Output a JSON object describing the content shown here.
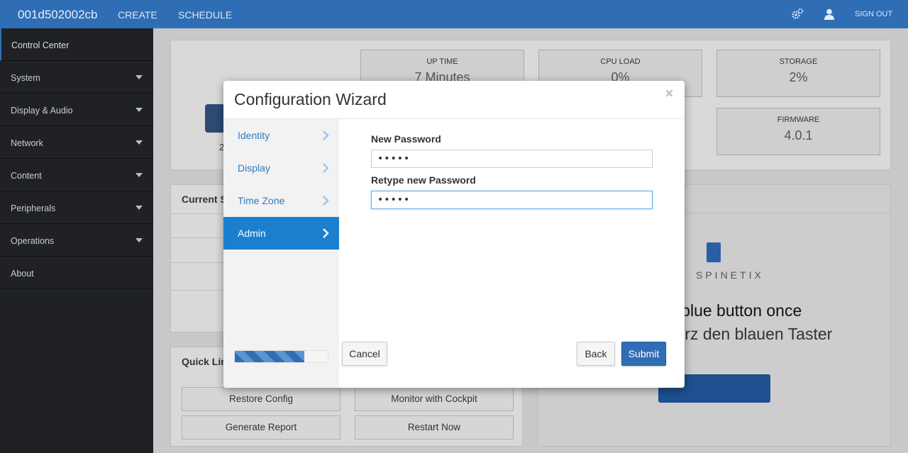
{
  "topbar": {
    "device_name": "001d502002cb",
    "create": "CREATE",
    "schedule": "SCHEDULE",
    "signout": "SIGN OUT"
  },
  "sidebar": {
    "items": [
      {
        "label": "Control Center"
      },
      {
        "label": "System"
      },
      {
        "label": "Display & Audio"
      },
      {
        "label": "Network"
      },
      {
        "label": "Content"
      },
      {
        "label": "Peripherals"
      },
      {
        "label": "Operations"
      },
      {
        "label": "About"
      }
    ]
  },
  "dashboard": {
    "uptime_label": "UP TIME",
    "uptime_value": "7 Minutes",
    "cpu_label": "CPU LOAD",
    "cpu_value": "0%",
    "storage_label": "STORAGE",
    "storage_value": "2%",
    "firmware_label": "FIRMWARE",
    "firmware_value": "4.0.1",
    "device_caption": "2",
    "current_status": "Current S",
    "quick_links": "Quick Lin",
    "restore_config": "Restore Config",
    "monitor_cockpit": "Monitor with Cockpit",
    "generate_report": "Generate Report",
    "restart_now": "Restart Now",
    "promo_brand": "SPINETIX",
    "promo_line1": "e blue button once",
    "promo_line2": "kurz den blauen Taster"
  },
  "modal": {
    "title": "Configuration Wizard",
    "close": "×",
    "steps": [
      {
        "label": "Identity"
      },
      {
        "label": "Display"
      },
      {
        "label": "Time Zone"
      },
      {
        "label": "Admin"
      }
    ],
    "active_step": "Admin",
    "progress": 0.75,
    "new_password_label": "New Password",
    "new_password_value": "•••••",
    "retype_password_label": "Retype new Password",
    "retype_password_value": "•••••",
    "cancel": "Cancel",
    "back": "Back",
    "submit": "Submit"
  },
  "colors": {
    "brand": "#2f6eb5",
    "active_step": "#1c7fcd",
    "sidebar_bg": "#1f2124"
  }
}
